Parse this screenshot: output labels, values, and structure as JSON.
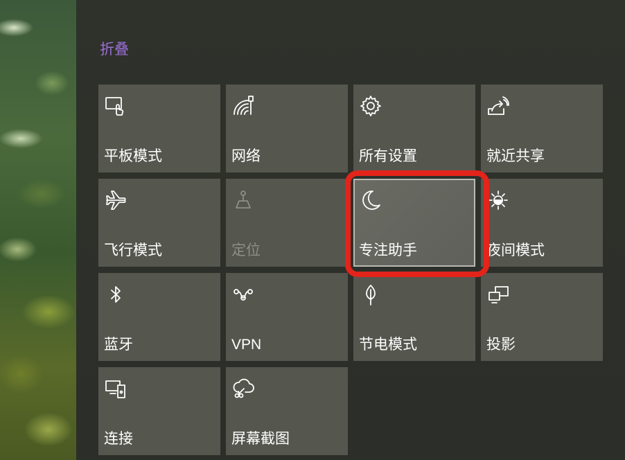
{
  "action_center": {
    "collapse_label": "折叠",
    "tiles": [
      {
        "label": "平板模式",
        "icon": "tablet-mode-icon",
        "state": "normal"
      },
      {
        "label": "网络",
        "icon": "network-icon",
        "state": "normal"
      },
      {
        "label": "所有设置",
        "icon": "settings-gear-icon",
        "state": "normal"
      },
      {
        "label": "就近共享",
        "icon": "nearby-share-icon",
        "state": "normal"
      },
      {
        "label": "飞行模式",
        "icon": "airplane-icon",
        "state": "normal"
      },
      {
        "label": "定位",
        "icon": "location-icon",
        "state": "disabled"
      },
      {
        "label": "专注助手",
        "icon": "moon-icon",
        "state": "focused"
      },
      {
        "label": "夜间模式",
        "icon": "sun-icon",
        "state": "normal"
      },
      {
        "label": "蓝牙",
        "icon": "bluetooth-icon",
        "state": "normal"
      },
      {
        "label": "VPN",
        "icon": "vpn-icon",
        "state": "normal"
      },
      {
        "label": "节电模式",
        "icon": "leaf-icon",
        "state": "normal"
      },
      {
        "label": "投影",
        "icon": "project-icon",
        "state": "normal"
      },
      {
        "label": "连接",
        "icon": "connect-icon",
        "state": "normal"
      },
      {
        "label": "屏幕截图",
        "icon": "snip-sketch-icon",
        "state": "normal"
      }
    ]
  },
  "colors": {
    "collapse_link": "#9b6fd6",
    "tile": "#55564e",
    "highlight": "#e3241b"
  }
}
